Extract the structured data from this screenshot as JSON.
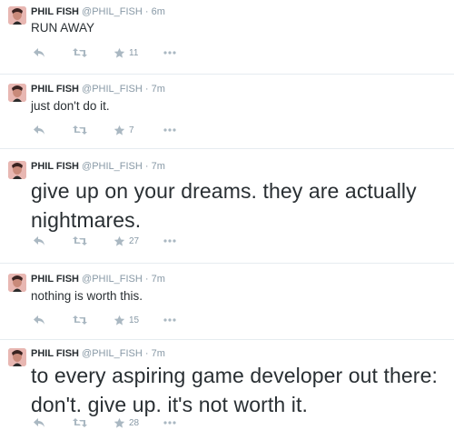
{
  "tweets": [
    {
      "fullname": "PHIL FISH",
      "handle": "@PHIL_FISH",
      "dot": "·",
      "time": "6m",
      "text": "RUN AWAY",
      "favorites": "11"
    },
    {
      "fullname": "PHIL FISH",
      "handle": "@PHIL_FISH",
      "dot": "·",
      "time": "7m",
      "text": "just don't do it.",
      "favorites": "7"
    },
    {
      "fullname": "PHIL FISH",
      "handle": "@PHIL_FISH",
      "dot": "·",
      "time": "7m",
      "text": "give up on your dreams. they are actually nightmares.",
      "favorites": "27"
    },
    {
      "fullname": "PHIL FISH",
      "handle": "@PHIL_FISH",
      "dot": "·",
      "time": "7m",
      "text": "nothing is worth this.",
      "favorites": "15"
    },
    {
      "fullname": "PHIL FISH",
      "handle": "@PHIL_FISH",
      "dot": "·",
      "time": "7m",
      "text": "to every aspiring game developer out there: don't. give up. it's not worth it.",
      "favorites": "28"
    }
  ],
  "icons": {
    "reply": "reply-icon",
    "retweet": "retweet-icon",
    "favorite": "star-icon",
    "more": "more-icon"
  },
  "colors": {
    "icon": "#aab8c2",
    "meta": "#8899a6",
    "text": "#292f33"
  }
}
